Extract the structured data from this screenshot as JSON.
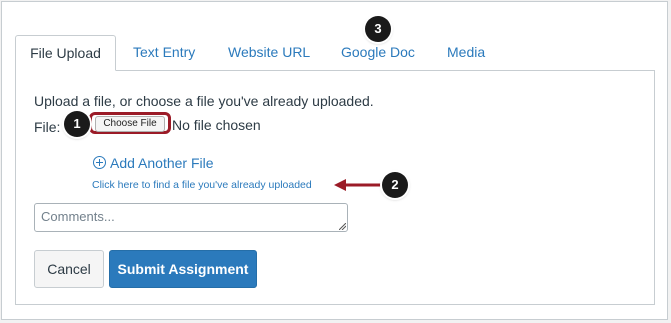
{
  "tabs": [
    {
      "label": "File Upload",
      "active": true
    },
    {
      "label": "Text Entry",
      "active": false
    },
    {
      "label": "Website URL",
      "active": false
    },
    {
      "label": "Google Doc",
      "active": false
    },
    {
      "label": "Media",
      "active": false
    }
  ],
  "upload": {
    "instructions": "Upload a file, or choose a file you've already uploaded.",
    "file_label": "File:",
    "choose_button": "Choose File",
    "status": "No file chosen",
    "add_another": "Add Another File",
    "find_uploaded": "Click here to find a file you've already uploaded"
  },
  "comments": {
    "placeholder": "Comments..."
  },
  "actions": {
    "cancel": "Cancel",
    "submit": "Submit Assignment"
  },
  "callouts": {
    "one": "1",
    "two": "2",
    "three": "3"
  },
  "colors": {
    "link": "#2b7abc",
    "highlight": "#9b1b27",
    "badge": "#1a1a1a"
  }
}
